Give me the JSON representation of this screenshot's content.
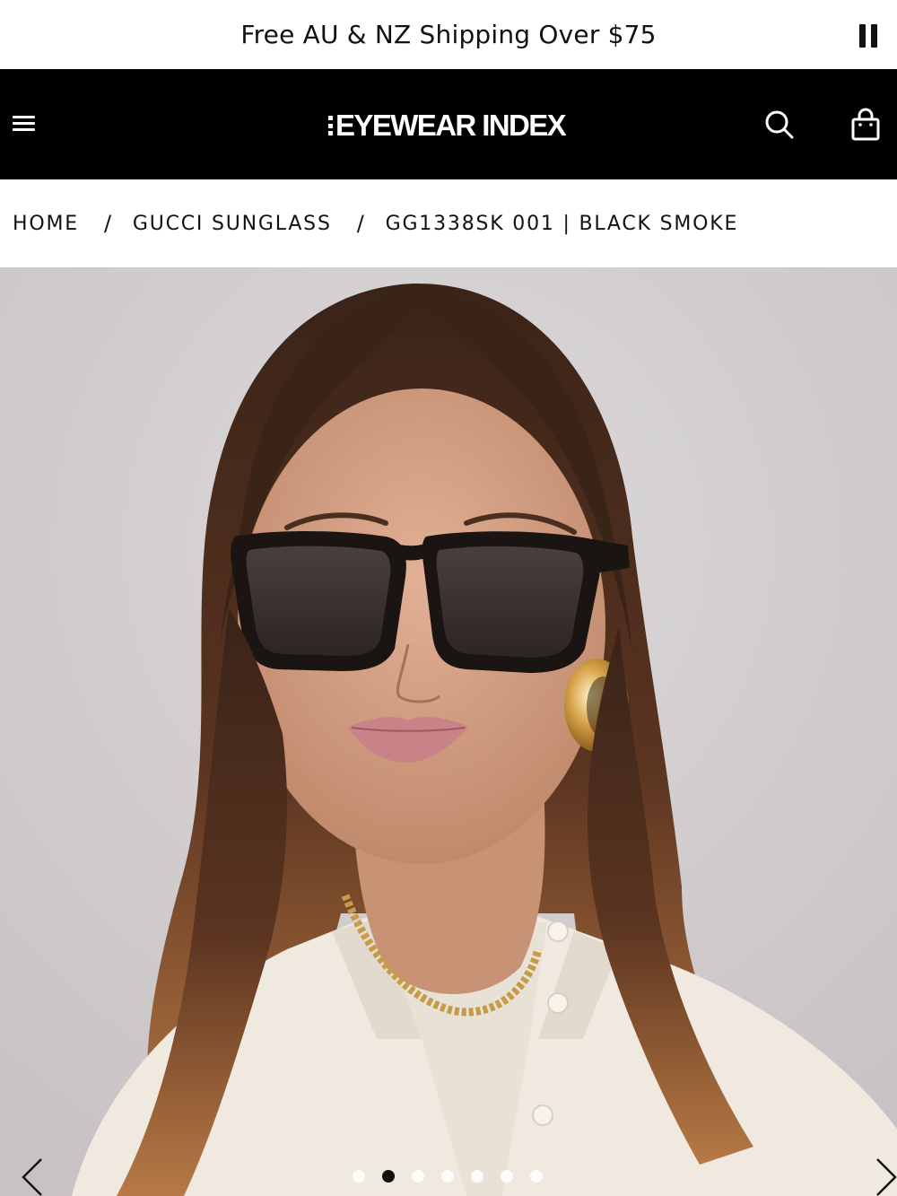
{
  "announcement": {
    "text": "Free AU & NZ Shipping Over $75",
    "pause_icon": "pause-icon"
  },
  "header": {
    "logo_text": "EYEWEAR INDEX",
    "menu_icon": "hamburger-menu-icon",
    "search_icon": "search-icon",
    "cart_icon": "shopping-bag-icon"
  },
  "breadcrumb": {
    "items": [
      {
        "label": "HOME"
      },
      {
        "label": "GUCCI SUNGLASS"
      },
      {
        "label": "GG1338SK 001 | BLACK SMOKE"
      }
    ],
    "separator": "/"
  },
  "gallery": {
    "image_description": "model-wearing-black-square-sunglasses",
    "dot_count": 7,
    "active_index": 1,
    "prev_icon": "chevron-left-icon",
    "next_icon": "chevron-right-icon"
  },
  "colors": {
    "header_bg": "#000000",
    "text": "#111111",
    "background": "#ffffff"
  }
}
